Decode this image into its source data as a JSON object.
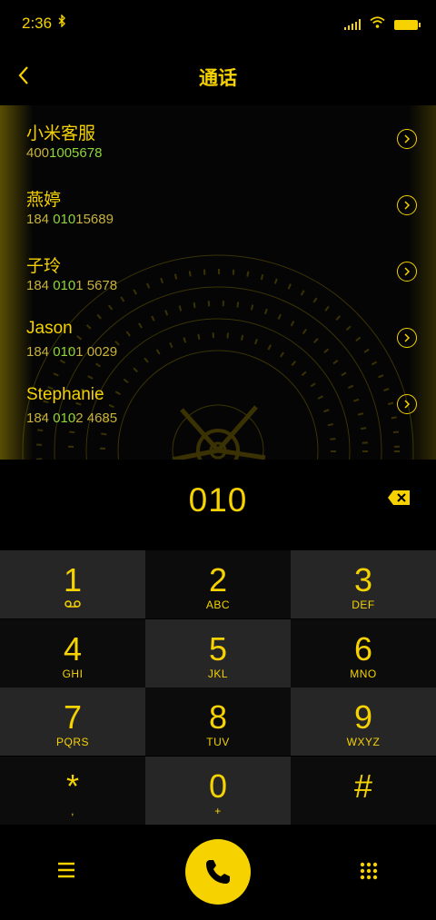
{
  "status_bar": {
    "time": "2:36",
    "bluetooth": "bluetooth-icon",
    "signal": "signal-icon",
    "wifi": "wifi-icon",
    "battery": "battery-icon"
  },
  "header": {
    "title": "通话",
    "back_icon": "chevron-left-icon"
  },
  "contacts": [
    {
      "name": "小米客服",
      "num_pre": "400",
      "num_hl": "1005678",
      "num_post": "",
      "raw": "4001005678"
    },
    {
      "name": "燕婷",
      "num_pre": "184 ",
      "num_hl": "010",
      "num_post": "15689"
    },
    {
      "name": "子玲",
      "num_pre": "184 ",
      "num_hl": "010",
      "num_post": "1 5678"
    },
    {
      "name": "Jason",
      "num_pre": "184 ",
      "num_hl": "010",
      "num_post": "1 0029"
    },
    {
      "name": "Stephanie",
      "num_pre": "184 ",
      "num_hl": "010",
      "num_post": "2 4685"
    }
  ],
  "display": {
    "digits": "010"
  },
  "keypad": [
    {
      "digit": "1",
      "letters": ""
    },
    {
      "digit": "2",
      "letters": "ABC"
    },
    {
      "digit": "3",
      "letters": "DEF"
    },
    {
      "digit": "4",
      "letters": "GHI"
    },
    {
      "digit": "5",
      "letters": "JKL"
    },
    {
      "digit": "6",
      "letters": "MNO"
    },
    {
      "digit": "7",
      "letters": "PQRS"
    },
    {
      "digit": "8",
      "letters": "TUV"
    },
    {
      "digit": "9",
      "letters": "WXYZ"
    },
    {
      "digit": "*",
      "letters": ","
    },
    {
      "digit": "0",
      "letters": "+"
    },
    {
      "digit": "#",
      "letters": ""
    }
  ],
  "colors": {
    "accent": "#f5d200",
    "number": "#c8b23c",
    "match": "#8ed63a",
    "key_light": "#262626",
    "key_dark": "#0c0c0c"
  },
  "bottom": {
    "menu_icon": "menu-icon",
    "call_icon": "phone-icon",
    "keypad_icon": "dialpad-icon"
  }
}
